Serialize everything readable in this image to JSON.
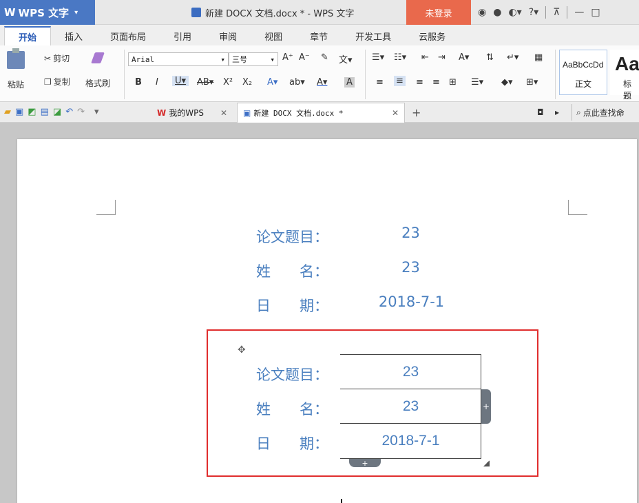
{
  "titlebar": {
    "app_name": "WPS 文字",
    "document_title": "新建 DOCX 文档.docx * - WPS 文字",
    "login_label": "未登录",
    "icons": [
      "shirt-icon",
      "settings-icon",
      "skin-icon",
      "help-icon",
      "upload-icon",
      "minimize-icon",
      "maximize-icon"
    ]
  },
  "menu": {
    "tabs": [
      "开始",
      "插入",
      "页面布局",
      "引用",
      "审阅",
      "视图",
      "章节",
      "开发工具",
      "云服务"
    ],
    "active": "开始"
  },
  "ribbon": {
    "paste_label": "粘贴",
    "cut_label": "剪切",
    "copy_label": "复制",
    "format_painter_label": "格式刷",
    "font_name": "Arial",
    "font_size": "三号",
    "styles": [
      {
        "preview": "AaBbCcDd",
        "name": "正文"
      },
      {
        "preview": "Aa",
        "name": "标题"
      }
    ]
  },
  "quickbar": {
    "doc_tabs": [
      {
        "label": "我的WPS",
        "active": false
      },
      {
        "label": "新建 DOCX 文档.docx *",
        "active": true
      }
    ],
    "search_placeholder": "点此查找命"
  },
  "document": {
    "header_fields": [
      {
        "label": "论文题目：",
        "value": "23"
      },
      {
        "label": "姓　　名：",
        "value": "23"
      },
      {
        "label": "日　　期：",
        "value": "2018-7-1"
      }
    ],
    "table_fields": [
      {
        "label": "论文题目：",
        "value": "23"
      },
      {
        "label": "姓　　名：",
        "value": "23"
      },
      {
        "label": "日　　期：",
        "value": "2018-7-1"
      }
    ]
  },
  "colors": {
    "accent_blue": "#4a7fbf",
    "title_blue": "#4a78c4",
    "login_orange": "#e9694c",
    "highlight_red": "#e02d2d"
  }
}
